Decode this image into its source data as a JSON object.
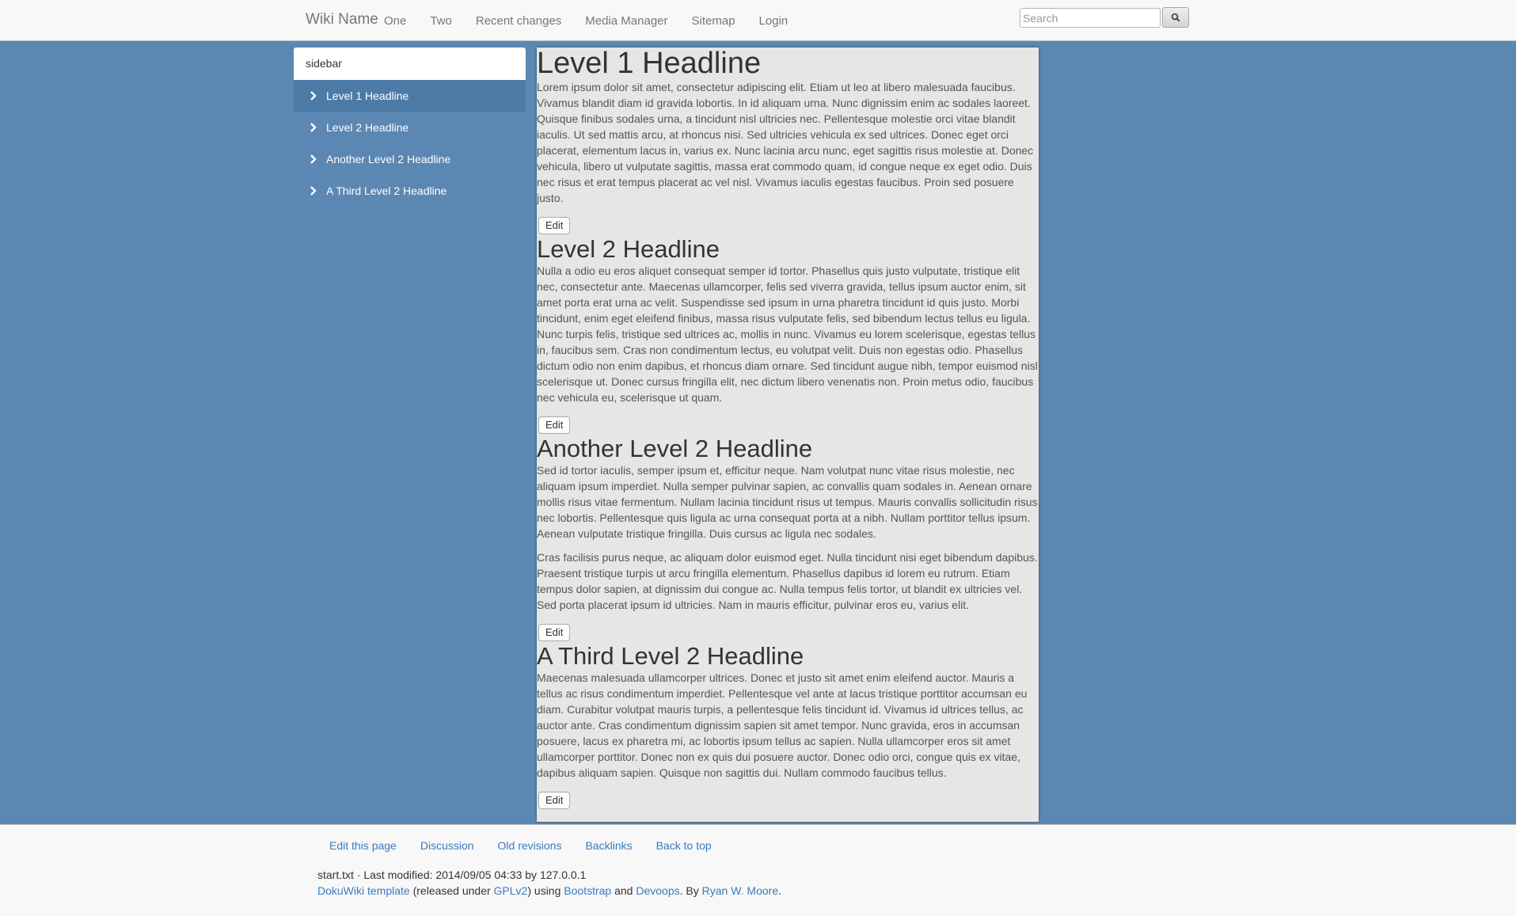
{
  "navbar": {
    "brand": "Wiki Name",
    "items": [
      "One",
      "Two",
      "Recent changes",
      "Media Manager",
      "Sitemap",
      "Login"
    ],
    "search_placeholder": "Search"
  },
  "sidebar": {
    "title": "sidebar",
    "items": [
      {
        "label": "Level 1 Headline",
        "active": true
      },
      {
        "label": "Level 2 Headline"
      },
      {
        "label": "Another Level 2 Headline"
      },
      {
        "label": "A Third Level 2 Headline"
      }
    ]
  },
  "content": {
    "edit_label": "Edit",
    "sections": [
      {
        "heading": "Level 1 Headline",
        "paragraphs": [
          "Lorem ipsum dolor sit amet, consectetur adipiscing elit. Etiam ut leo at libero malesuada faucibus. Vivamus blandit diam id gravida lobortis. In id aliquam urna. Nunc dignissim enim ac sodales laoreet. Quisque finibus sodales urna, a tincidunt nisl ultricies nec. Pellentesque molestie orci vitae blandit iaculis. Ut sed mattis arcu, at rhoncus nisi. Sed ultricies vehicula ex sed ultrices. Donec eget orci placerat, elementum lacus in, varius ex. Nunc lacinia arcu nunc, eget sagittis risus molestie at. Donec vehicula, libero ut vulputate sagittis, massa erat commodo quam, id congue neque ex eget odio. Duis nec risus et erat tempus placerat ac vel nisl. Vivamus iaculis egestas faucibus. Proin sed posuere justo."
        ]
      },
      {
        "heading": "Level 2 Headline",
        "paragraphs": [
          "Nulla a odio eu eros aliquet consequat semper id tortor. Phasellus quis justo vulputate, tristique elit nec, consectetur ante. Maecenas ullamcorper, felis sed viverra gravida, tellus ipsum auctor enim, sit amet porta erat urna ac velit. Suspendisse sed ipsum in urna pharetra tincidunt id quis justo. Morbi tincidunt, enim eget eleifend finibus, massa risus vulputate felis, sed bibendum lectus tellus eu ligula. Nunc turpis felis, tristique sed ultrices ac, mollis in nunc. Vivamus eu lorem scelerisque, egestas tellus in, faucibus sem. Cras non condimentum lectus, eu volutpat velit. Duis non egestas odio. Phasellus dictum odio non enim dapibus, et rhoncus diam ornare. Sed tincidunt augue nibh, tempor euismod nisl scelerisque ut. Donec cursus fringilla elit, nec dictum libero venenatis non. Proin metus odio, faucibus nec vehicula eu, scelerisque ut quam."
        ]
      },
      {
        "heading": "Another Level 2 Headline",
        "paragraphs": [
          "Sed id tortor iaculis, semper ipsum et, efficitur neque. Nam volutpat nunc vitae risus molestie, nec aliquam ipsum imperdiet. Nulla semper pulvinar sapien, ac convallis quam sodales in. Aenean ornare mollis risus vitae fermentum. Nullam lacinia tincidunt risus ut tempus. Mauris convallis sollicitudin risus nec lobortis. Pellentesque quis ligula ac urna consequat porta at a nibh. Nullam porttitor tellus ipsum. Aenean vulputate tristique fringilla. Duis cursus ac ligula nec sodales.",
          "Cras facilisis purus neque, ac aliquam dolor euismod eget. Nulla tincidunt nisi eget bibendum dapibus. Praesent tristique turpis ut arcu fringilla elementum. Phasellus dapibus id lorem eu rutrum. Etiam tempus dolor sapien, at dignissim dui congue ac. Nulla tempus felis tortor, ut blandit ex ultricies vel. Sed porta placerat ipsum id ultricies. Nam in mauris efficitur, pulvinar eros eu, varius elit."
        ]
      },
      {
        "heading": "A Third Level 2 Headline",
        "paragraphs": [
          "Maecenas malesuada ullamcorper ultrices. Donec et justo sit amet enim eleifend auctor. Mauris a tellus ac risus condimentum imperdiet. Pellentesque vel ante at lacus tristique porttitor accumsan eu diam. Curabitur volutpat mauris turpis, a pellentesque felis tincidunt id. Vivamus id ultrices tellus, ac auctor ante. Cras condimentum dignissim sapien sit amet tempor. Nunc gravida, eros in accumsan posuere, lacus ex pharetra mi, ac lobortis ipsum tellus ac sapien. Nulla ullamcorper eros sit amet ullamcorper porttitor. Donec non ex quis dui posuere auctor. Donec odio orci, congue quis ex vitae, dapibus aliquam sapien. Quisque non sagittis dui. Nullam commodo faucibus tellus."
        ]
      }
    ]
  },
  "footer": {
    "links": [
      "Edit this page",
      "Discussion",
      "Old revisions",
      "Backlinks",
      "Back to top"
    ],
    "last_modified": "start.txt · Last modified: 2014/09/05 04:33 by 127.0.0.1",
    "credit": {
      "template_link": "DokuWiki template",
      "text_1": " (released under ",
      "license_link": "GPLv2",
      "text_2": ") using ",
      "bootstrap_link": "Bootstrap",
      "text_3": " and ",
      "devoops_link": "Devoops",
      "text_4": ". By ",
      "author_link": "Ryan W. Moore",
      "text_5": "."
    }
  },
  "colors": {
    "background": "#5b87b3",
    "link": "#3a7abf",
    "sidebar_active": "#4d7ba8"
  },
  "icons": {
    "search": "search-icon",
    "sidebar_bullet": "chevron-right-icon"
  }
}
